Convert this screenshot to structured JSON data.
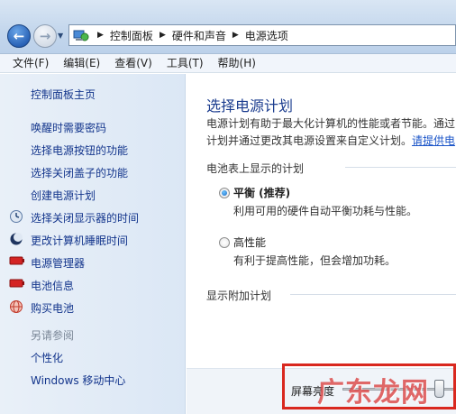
{
  "address_bar": {
    "crumbs": [
      "控制面板",
      "硬件和声音",
      "电源选项"
    ]
  },
  "menu": [
    "文件(F)",
    "编辑(E)",
    "查看(V)",
    "工具(T)",
    "帮助(H)"
  ],
  "left_pane": {
    "home": "控制面板主页",
    "links": [
      "唤醒时需要密码",
      "选择电源按钮的功能",
      "选择关闭盖子的功能",
      "创建电源计划",
      "选择关闭显示器的时间",
      "更改计算机睡眠时间",
      "电源管理器",
      "电池信息",
      "购买电池"
    ],
    "see_also_heading": "另请参阅",
    "see_also": [
      "个性化",
      "Windows 移动中心"
    ]
  },
  "main": {
    "title": "选择电源计划",
    "desc_line1": "电源计划有助于最大化计算机的性能或者节能。通过",
    "desc_line2": "计划并通过更改其电源设置来自定义计划。",
    "desc_link": "请提供电",
    "plans_heading": "电池表上显示的计划",
    "plans": [
      {
        "name": "平衡 (推荐)",
        "desc": "利用可用的硬件自动平衡功耗与性能。",
        "selected": true
      },
      {
        "name": "高性能",
        "desc": "有利于提高性能，但会增加功耗。",
        "selected": false
      }
    ],
    "additional_heading": "显示附加计划"
  },
  "brightness": {
    "label": "屏幕亮度",
    "level_percent": 85
  },
  "watermark": "广东龙网"
}
